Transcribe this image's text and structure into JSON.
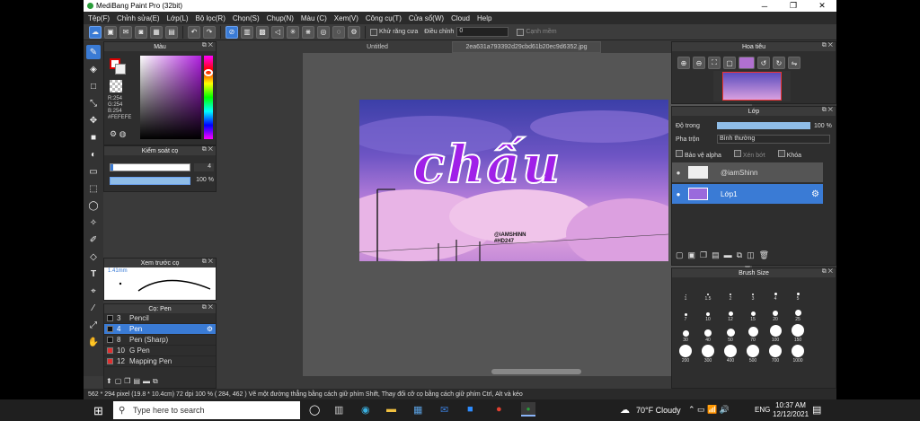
{
  "window": {
    "title": "MediBang Paint Pro (32bit)",
    "minimize": "─",
    "maximize": "❐",
    "close": "✕"
  },
  "menu": [
    "Tệp(F)",
    "Chỉnh sửa(E)",
    "Lớp(L)",
    "Bộ lọc(R)",
    "Chọn(S)",
    "Chụp(N)",
    "Màu (C)",
    "Xem(V)",
    "Công cụ(T)",
    "Cửa sổ(W)",
    "Cloud",
    "Help"
  ],
  "toolbar": {
    "antialias_label": "Khử răng cưa",
    "adjust_label": "Điều chỉnh",
    "adjust_value": "0",
    "snap_label": "Cạnh mềm"
  },
  "color_panel": {
    "title": "Màu",
    "r": "R:254",
    "g": "G:254",
    "b": "B:254",
    "hex": "#FEFEFE"
  },
  "brush_control": {
    "title": "Kiểm soát cọ",
    "size": "4",
    "opacity": "100 %"
  },
  "brush_preview": {
    "title": "Xem trước cọ",
    "size": "1.41mm"
  },
  "brush_panel": {
    "title": "Cọ: Pen",
    "items": [
      {
        "num": "3",
        "name": "Pencil",
        "color": "#111111"
      },
      {
        "num": "4",
        "name": "Pen",
        "color": "#111111",
        "selected": true
      },
      {
        "num": "8",
        "name": "Pen (Sharp)",
        "color": "#111111"
      },
      {
        "num": "10",
        "name": "G Pen",
        "color": "#e03030"
      },
      {
        "num": "12",
        "name": "Mapping Pen",
        "color": "#e03030"
      }
    ]
  },
  "tabs": [
    "Untitled",
    "2ea631a793392d29cbd61b20ec9d6352.jpg"
  ],
  "artwork": {
    "text": "chấu",
    "credit1": "@iAMSHINN",
    "credit2": "#HD247"
  },
  "navigator": {
    "title": "Hoa tiêu"
  },
  "layers_panel": {
    "title": "Lớp",
    "opacity_label": "Độ trong",
    "opacity_value": "100 %",
    "blend_label": "Pha trộn",
    "blend_value": "Bình thường",
    "protect_alpha": "Bảo vệ alpha",
    "clip": "Xén bớt",
    "lock": "Khóa",
    "layers": [
      {
        "name": "@iamShinn",
        "selected": false
      },
      {
        "name": "Lớp1",
        "selected": true
      }
    ]
  },
  "brush_size": {
    "title": "Brush Size",
    "sizes": [
      "1",
      "1.5",
      "2",
      "3",
      "4",
      "5",
      "7",
      "10",
      "12",
      "15",
      "20",
      "25",
      "30",
      "40",
      "50",
      "70",
      "100",
      "150",
      "200",
      "300",
      "400",
      "500",
      "700",
      "1000"
    ]
  },
  "status": {
    "text": "562 * 294 pixel  (19.8 * 10.4cm)  72 dpi  100 %  ( 284, 462 )  Vẽ một đường thẳng bằng cách giữ phím Shift, Thay đổi cỡ cọ bằng cách giữ phím Ctrl, Alt và kéo"
  },
  "taskbar": {
    "search_placeholder": "Type here to search",
    "weather": "70°F  Cloudy",
    "lang": "ENG",
    "time": "10:37 AM",
    "date": "12/12/2021"
  }
}
